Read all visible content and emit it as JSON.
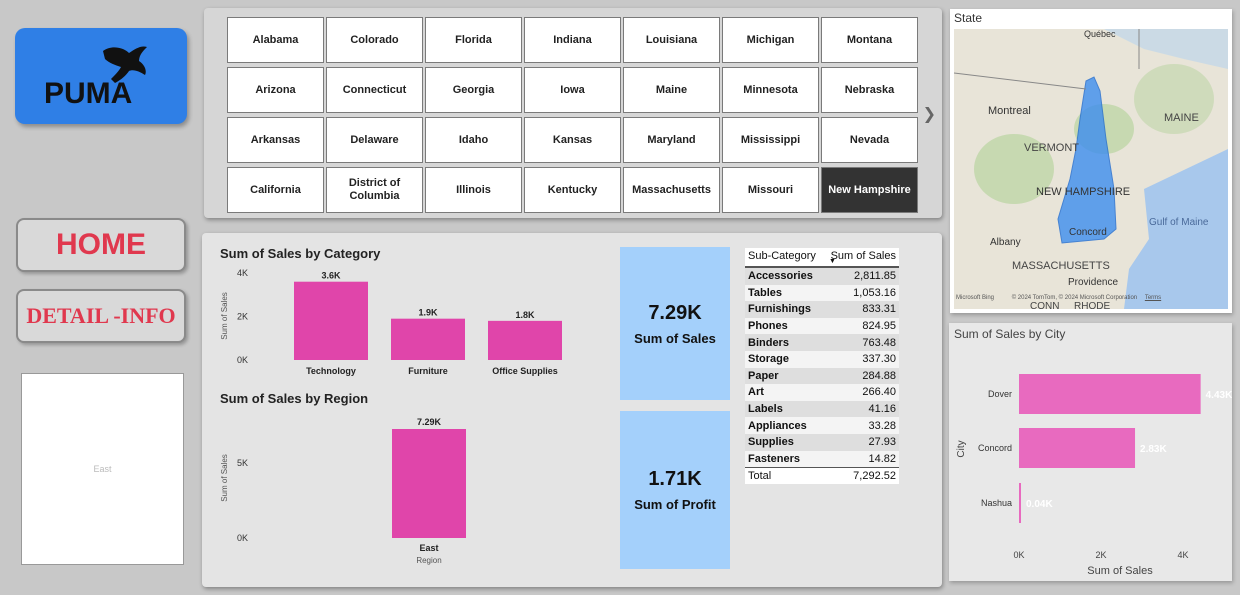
{
  "brand": {
    "logo_text": "PUMA"
  },
  "nav": {
    "home": "HOME",
    "detail": "DETAIL -INFO"
  },
  "region_card": {
    "label": "East"
  },
  "states": [
    "Alabama",
    "Colorado",
    "Florida",
    "Indiana",
    "Louisiana",
    "Michigan",
    "Montana",
    "Arizona",
    "Connecticut",
    "Georgia",
    "Iowa",
    "Maine",
    "Minnesota",
    "Nebraska",
    "Arkansas",
    "Delaware",
    "Idaho",
    "Kansas",
    "Maryland",
    "Mississippi",
    "Nevada",
    "California",
    "District of Columbia",
    "Illinois",
    "Kentucky",
    "Massachusetts",
    "Missouri",
    "New Hampshire"
  ],
  "selected_state": "New Hampshire",
  "colors": {
    "bar": "#e045aa",
    "city_bar": "#e86abf",
    "kpi": "#a4d0fb",
    "logo_bg": "#2f7fe6",
    "nav_text": "#e0384e"
  },
  "category_chart": {
    "title": "Sum of Sales by Category",
    "ylabel": "Sum of Sales",
    "yticks": [
      "4K",
      "2K",
      "0K"
    ]
  },
  "region_chart": {
    "title": "Sum of Sales by Region",
    "ylabel": "Sum of Sales",
    "xlabel": "Region",
    "yticks": [
      "5K",
      "0K"
    ]
  },
  "kpis": {
    "sales_value": "7.29K",
    "sales_label": "Sum of Sales",
    "profit_value": "1.71K",
    "profit_label": "Sum of Profit"
  },
  "table": {
    "headers": [
      "Sub-Category",
      "Sum of Sales"
    ],
    "rows": [
      [
        "Accessories",
        "2,811.85"
      ],
      [
        "Tables",
        "1,053.16"
      ],
      [
        "Furnishings",
        "833.31"
      ],
      [
        "Phones",
        "824.95"
      ],
      [
        "Binders",
        "763.48"
      ],
      [
        "Storage",
        "337.30"
      ],
      [
        "Paper",
        "284.88"
      ],
      [
        "Art",
        "266.40"
      ],
      [
        "Labels",
        "41.16"
      ],
      [
        "Appliances",
        "33.28"
      ],
      [
        "Supplies",
        "27.93"
      ],
      [
        "Fasteners",
        "14.82"
      ]
    ],
    "total_label": "Total",
    "total_value": "7,292.52"
  },
  "map": {
    "title": "State",
    "labels": [
      "Québec",
      "Montreal",
      "MAINE",
      "VERMONT",
      "NEW HAMPSHIRE",
      "Gulf of Maine",
      "Concord",
      "Albany",
      "MASSACHUSETTS",
      "Providence",
      "CONN",
      "RHODE"
    ],
    "attribution": "© 2024 TomTom, © 2024 Microsoft Corporation",
    "terms": "Terms",
    "bing": "Microsoft Bing"
  },
  "city_chart": {
    "title": "Sum of Sales by City",
    "ylabel": "City",
    "xlabel": "Sum of Sales",
    "xticks": [
      "0K",
      "2K",
      "4K"
    ]
  },
  "chart_data": [
    {
      "type": "bar",
      "title": "Sum of Sales by Category",
      "categories": [
        "Technology",
        "Furniture",
        "Office Supplies"
      ],
      "values": [
        3.6,
        1.9,
        1.8
      ],
      "labels": [
        "3.6K",
        "1.9K",
        "1.8K"
      ],
      "ylabel": "Sum of Sales",
      "ylim": [
        0,
        4
      ]
    },
    {
      "type": "bar",
      "title": "Sum of Sales by Region",
      "categories": [
        "East"
      ],
      "values": [
        7.29
      ],
      "labels": [
        "7.29K"
      ],
      "xlabel": "Region",
      "ylabel": "Sum of Sales",
      "ylim": [
        0,
        8
      ]
    },
    {
      "type": "bar",
      "title": "Sum of Sales by City",
      "categories": [
        "Dover",
        "Concord",
        "Nashua"
      ],
      "values": [
        4.43,
        2.83,
        0.04
      ],
      "labels": [
        "4.43K",
        "2.83K",
        "0.04K"
      ],
      "xlabel": "Sum of Sales",
      "ylabel": "City",
      "xlim": [
        0,
        5.6
      ]
    }
  ]
}
